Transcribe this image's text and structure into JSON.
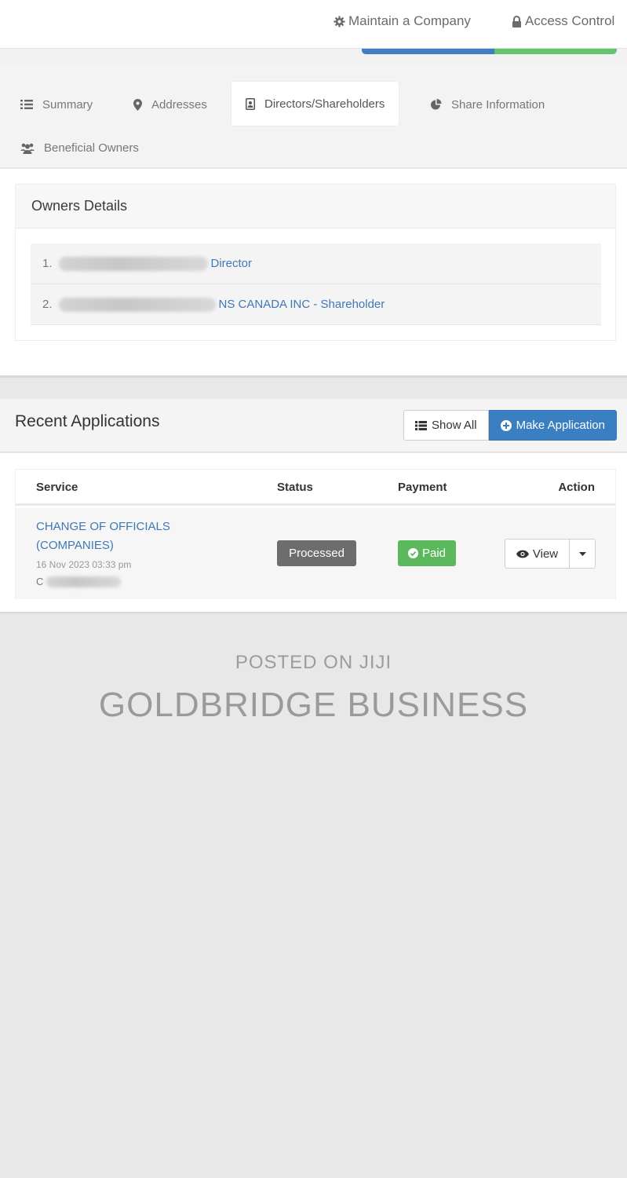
{
  "topnav": {
    "items": [
      {
        "label": "Maintain a Company",
        "icon": "gear-icon"
      },
      {
        "label": "Access Control",
        "icon": "lock-icon"
      }
    ]
  },
  "tabs": [
    {
      "label": "Summary",
      "icon": "list-icon",
      "active": false
    },
    {
      "label": "Addresses",
      "icon": "map-marker-icon",
      "active": false
    },
    {
      "label": "Directors/Shareholders",
      "icon": "id-badge-icon",
      "active": true
    },
    {
      "label": "Share Information",
      "icon": "pie-chart-icon",
      "active": false
    },
    {
      "label": "Beneficial Owners",
      "icon": "users-icon",
      "active": false
    }
  ],
  "owners": {
    "title": "Owners Details",
    "rows": [
      {
        "num": "1.",
        "suffix": "Director"
      },
      {
        "num": "2.",
        "suffix": "CANADA INC - Shareholder",
        "partial": "NS"
      }
    ]
  },
  "recent": {
    "title": "Recent Applications",
    "show_all_label": "Show All",
    "make_application_label": "Make Application",
    "columns": [
      "Service",
      "Status",
      "Payment",
      "Action"
    ],
    "rows": [
      {
        "service_line1": "CHANGE OF OFFICIALS",
        "service_line2": "(COMPANIES)",
        "date": "16 Nov 2023 03:33 pm",
        "by_initial": "C",
        "status": "Processed",
        "payment": "Paid",
        "view_label": "View"
      }
    ]
  },
  "watermark": {
    "line1": "POSTED ON JIJI",
    "line2": "GOLDBRIDGE BUSINESS"
  },
  "colors": {
    "link": "#3f78b5",
    "primary": "#3a7fc1",
    "success": "#5cb85c",
    "processed": "#6d6d6d"
  }
}
